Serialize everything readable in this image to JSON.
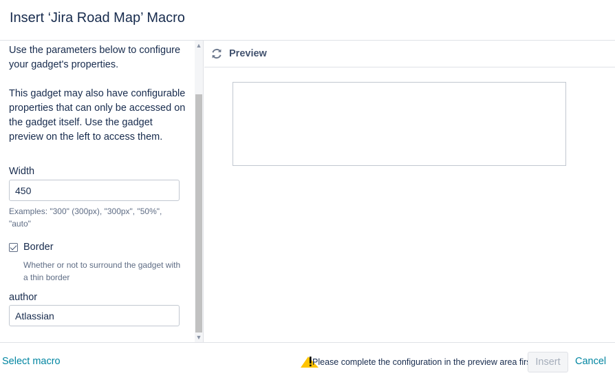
{
  "dialog": {
    "title": "Insert ‘Jira Road Map’ Macro"
  },
  "params": {
    "intro_line1": "Use the parameters below to configure your gadget's properties.",
    "intro_line2": "This gadget may also have configurable properties that can only be accessed on the gadget itself. Use the gadget preview on the left to access them.",
    "width": {
      "label": "Width",
      "value": "450",
      "help": "Examples: \"300\" (300px), \"300px\", \"50%\", \"auto\""
    },
    "border": {
      "label": "Border",
      "checked": true,
      "help": "Whether or not to surround the gadget with a thin border"
    },
    "author": {
      "label": "author",
      "value": "Atlassian"
    }
  },
  "preview": {
    "title": "Preview",
    "icon": "refresh-icon"
  },
  "footer": {
    "select_macro": "Select macro",
    "warning_icon": "warning-icon",
    "warning_text": "Please complete the configuration in the preview area first",
    "insert_label": "Insert",
    "cancel_label": "Cancel"
  },
  "colors": {
    "link": "#0085a1",
    "title": "#172b4d",
    "warning": "#ffc400"
  }
}
